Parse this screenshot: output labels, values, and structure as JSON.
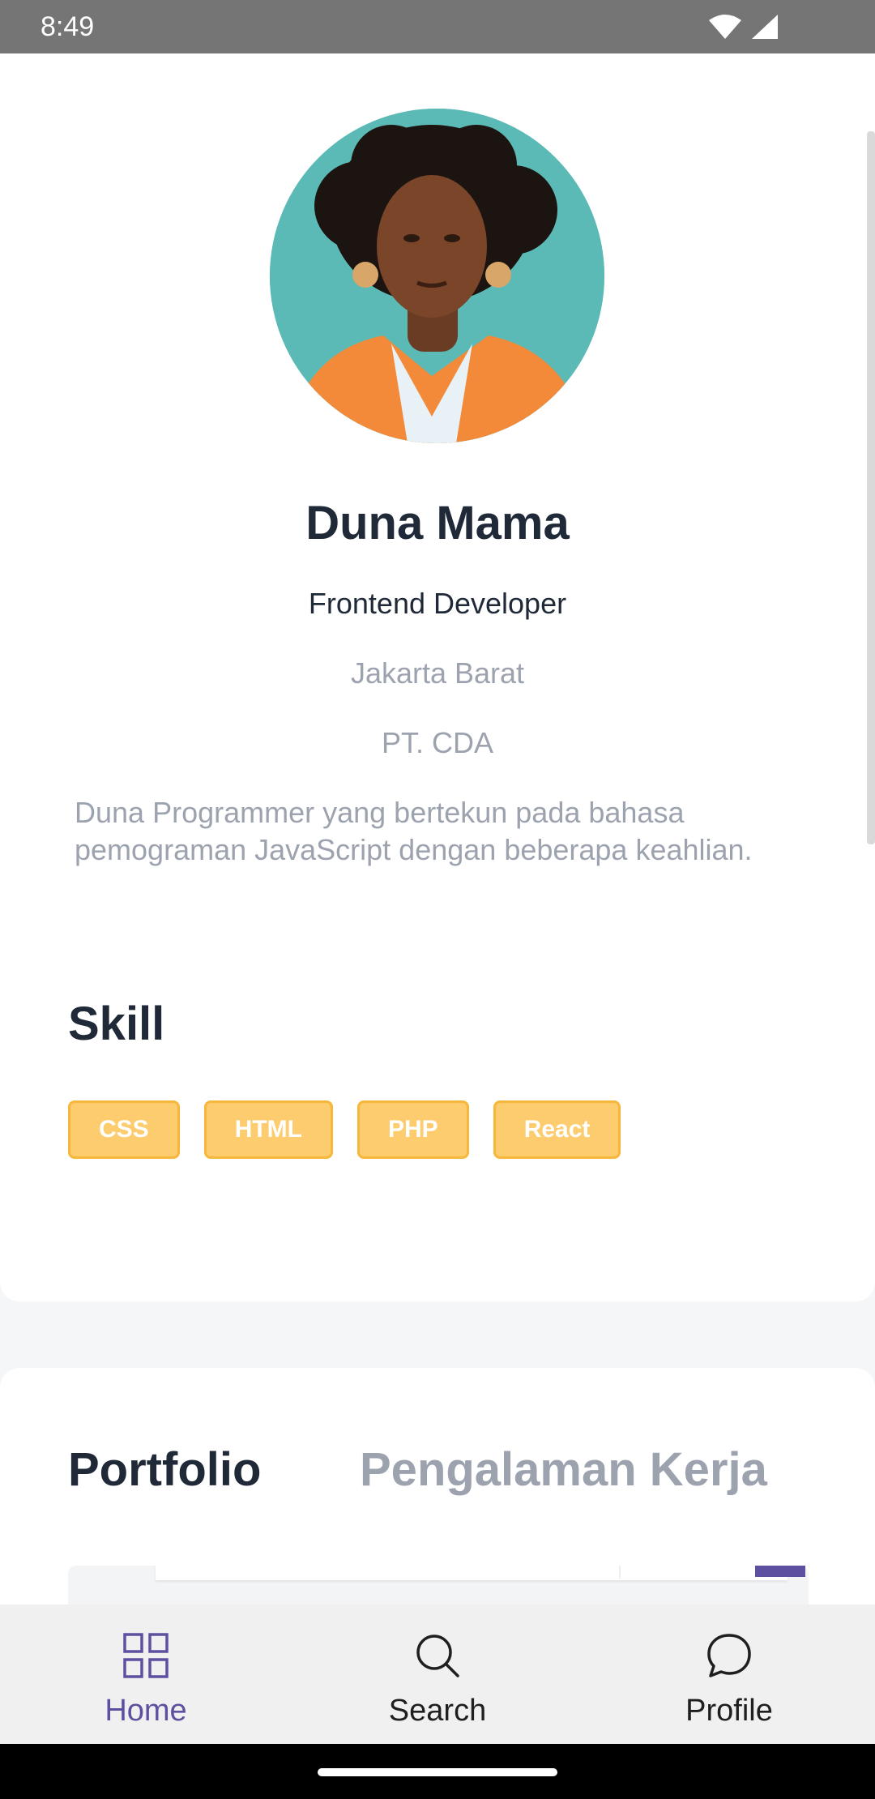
{
  "status_bar": {
    "time": "8:49"
  },
  "profile": {
    "name": "Duna Mama",
    "job": "Frontend Developer",
    "location": "Jakarta Barat",
    "company": "PT. CDA",
    "bio": "Duna Programmer yang bertekun pada bahasa pemograman JavaScript dengan beberapa keahlian."
  },
  "skills": {
    "title": "Skill",
    "items": [
      "CSS",
      "HTML",
      "PHP",
      "React"
    ]
  },
  "tabs": [
    {
      "label": "Portfolio",
      "active": true
    },
    {
      "label": "Pengalaman Kerja",
      "active": false
    }
  ],
  "bottom_nav": [
    {
      "label": "Home",
      "icon": "grid-icon",
      "active": true
    },
    {
      "label": "Search",
      "icon": "search-icon",
      "active": false
    },
    {
      "label": "Profile",
      "icon": "chat-bubble-icon",
      "active": false
    }
  ],
  "colors": {
    "accent": "#5e50a1",
    "skill_badge": "#fdcc6e",
    "skill_border": "#f6b73a",
    "text_dark": "#1f2937",
    "text_muted": "#9ca3af"
  }
}
